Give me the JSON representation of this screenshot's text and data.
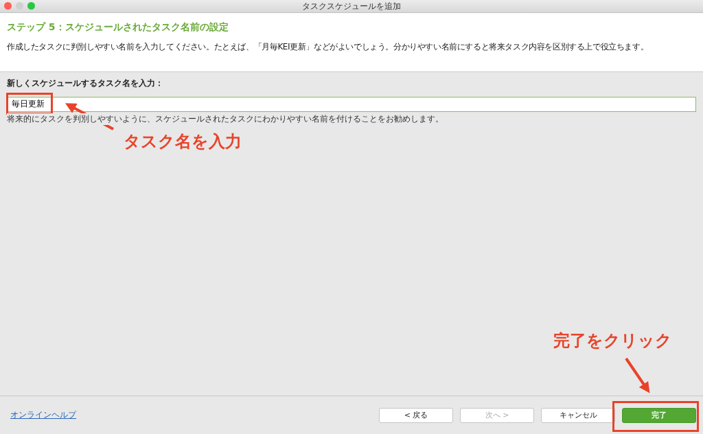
{
  "window": {
    "title": "タスクスケジュールを追加"
  },
  "header": {
    "title": "ステップ 5：スケジュールされたタスク名前の設定",
    "description": "作成したタスクに判別しやすい名前を入力してください。たとえば、「月毎KEI更新」などがよいでしょう。分かりやすい名前にすると将来タスク内容を区別する上で役立ちます。"
  },
  "name_field": {
    "label": "新しくスケジュールするタスク名を入力：",
    "value": "毎日更新",
    "hint": "将来的にタスクを判別しやすいように、スケジュールされたタスクにわかりやすい名前を付けることをお勧めします。"
  },
  "footer": {
    "help_link": "オンラインヘルプ",
    "buttons": [
      {
        "label": "< 戻る",
        "kind": "default",
        "disabled": false
      },
      {
        "label": "次へ >",
        "kind": "default",
        "disabled": true
      },
      {
        "label": "キャンセル",
        "kind": "default",
        "disabled": false
      },
      {
        "label": "完了",
        "kind": "primary",
        "disabled": false
      }
    ]
  },
  "annotations": [
    {
      "text": "タスク名を入力"
    },
    {
      "text": "完了をクリック"
    }
  ]
}
